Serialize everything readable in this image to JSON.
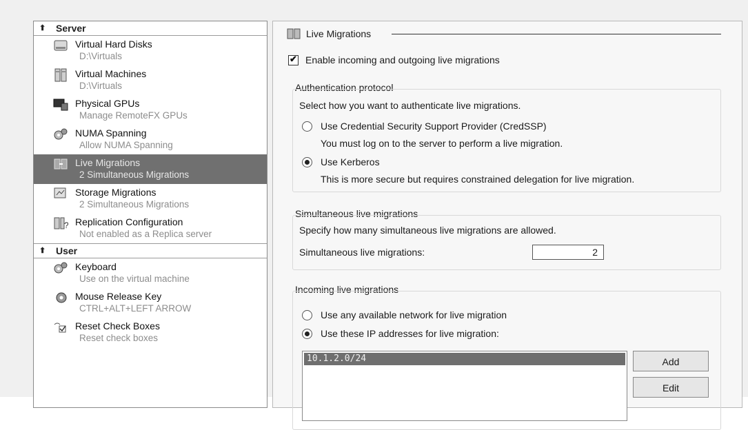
{
  "sidebar": {
    "sections": [
      {
        "label": "Server",
        "items": [
          {
            "title": "Virtual Hard Disks",
            "subtitle": "D:\\Virtuals",
            "icon": "hard-disk-icon"
          },
          {
            "title": "Virtual Machines",
            "subtitle": "D:\\Virtuals",
            "icon": "server-icon"
          },
          {
            "title": "Physical GPUs",
            "subtitle": "Manage RemoteFX GPUs",
            "icon": "gpu-monitor-icon"
          },
          {
            "title": "NUMA Spanning",
            "subtitle": "Allow NUMA Spanning",
            "icon": "gears-icon"
          },
          {
            "title": "Live Migrations",
            "subtitle": "2 Simultaneous Migrations",
            "icon": "migration-icon",
            "selected": true
          },
          {
            "title": "Storage Migrations",
            "subtitle": "2 Simultaneous Migrations",
            "icon": "storage-migration-icon"
          },
          {
            "title": "Replication Configuration",
            "subtitle": "Not enabled as a Replica server",
            "icon": "replication-icon"
          }
        ]
      },
      {
        "label": "User",
        "items": [
          {
            "title": "Keyboard",
            "subtitle": "Use on the virtual machine",
            "icon": "keyboard-gears-icon"
          },
          {
            "title": "Mouse Release Key",
            "subtitle": "CTRL+ALT+LEFT ARROW",
            "icon": "mouse-gear-icon"
          },
          {
            "title": "Reset Check Boxes",
            "subtitle": "Reset check boxes",
            "icon": "reset-checkbox-icon"
          }
        ]
      }
    ]
  },
  "main": {
    "title": "Live Migrations",
    "enable_checkbox": {
      "label": "Enable incoming and outgoing live migrations",
      "checked": true
    },
    "auth": {
      "group_label": "Authentication protocol",
      "description": "Select how you want to authenticate live migrations.",
      "option1_label": "Use Credential Security Support Provider (CredSSP)",
      "option1_note": "You must log on to the server to perform a live migration.",
      "option2_label": "Use Kerberos",
      "option2_note": "This is more secure but requires constrained delegation for live migration.",
      "selected": "kerberos"
    },
    "simultaneous": {
      "group_label": "Simultaneous live migrations",
      "description": "Specify how many simultaneous live migrations are allowed.",
      "field_label": "Simultaneous live migrations:",
      "value": "2"
    },
    "incoming": {
      "group_label": "Incoming live migrations",
      "option1_label": "Use any available network for live migration",
      "option2_label": "Use these IP addresses for live migration:",
      "selected": "ip",
      "ip_list": [
        "10.1.2.0/24"
      ],
      "add_label": "Add",
      "edit_label": "Edit"
    }
  }
}
